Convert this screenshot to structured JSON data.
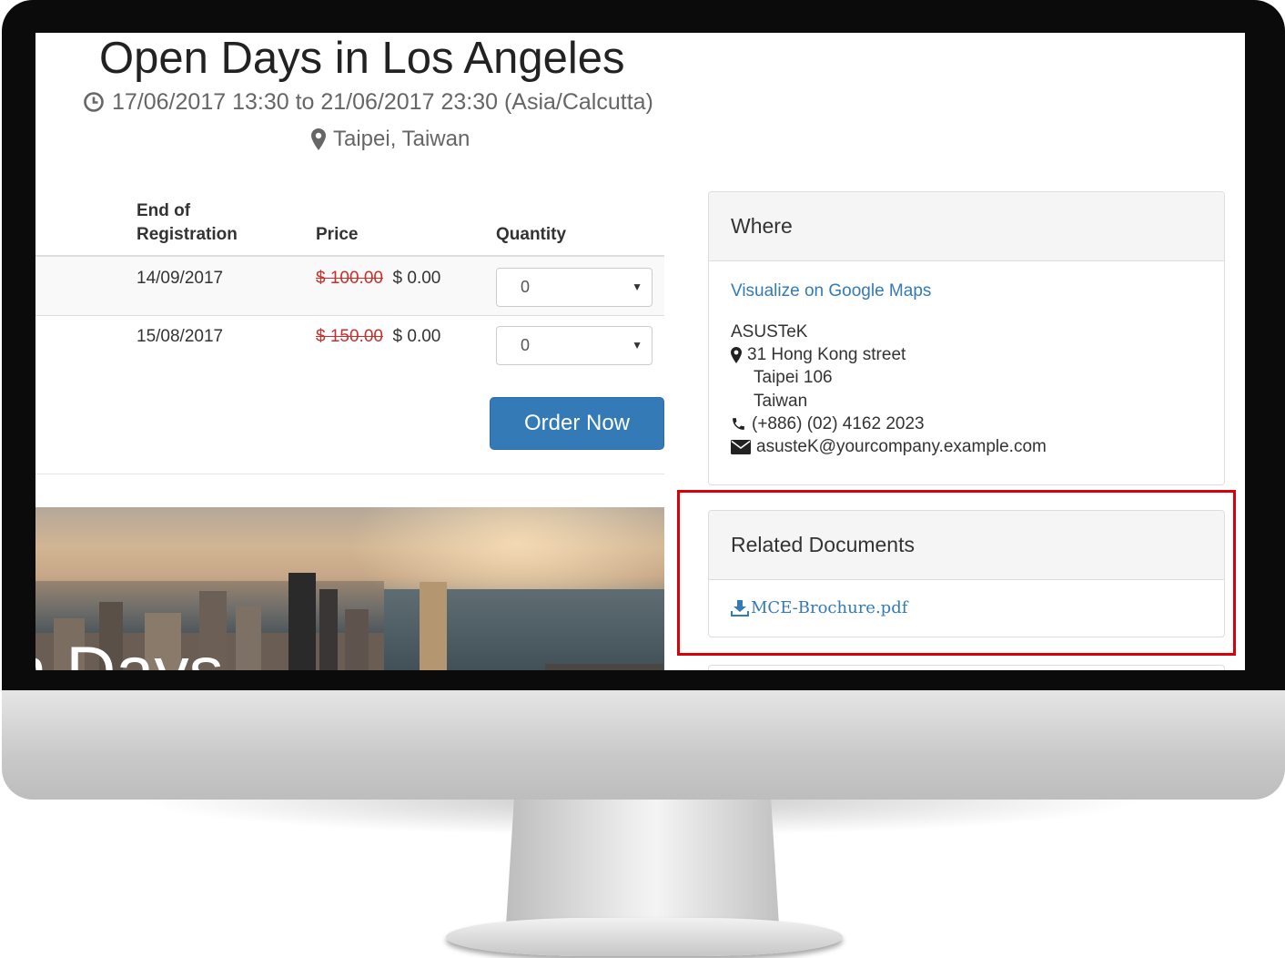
{
  "event": {
    "title": "Open Days in Los Angeles",
    "dates": "17/06/2017 13:30 to 21/06/2017 23:30 (Asia/Calcutta)",
    "location": "Taipei, Taiwan"
  },
  "tickets": {
    "headers": {
      "end_line1": "End of",
      "end_line2": "Registration",
      "price": "Price",
      "quantity": "Quantity"
    },
    "rows": [
      {
        "end": "14/09/2017",
        "old_price": "$ 100.00",
        "price": "$ 0.00",
        "quantity": "0"
      },
      {
        "end": "15/08/2017",
        "old_price": "$ 150.00",
        "price": "$ 0.00",
        "quantity": "0"
      }
    ],
    "order_label": "Order Now"
  },
  "banner": {
    "caption": "n Days"
  },
  "where": {
    "heading": "Where",
    "maps_link": "Visualize on Google Maps",
    "company": "ASUSTeK",
    "street": "31 Hong Kong street",
    "city": "Taipei 106",
    "country": "Taiwan",
    "phone": "(+886) (02) 4162 2023",
    "email": "asusteK@yourcompany.example.com"
  },
  "documents": {
    "heading": "Related Documents",
    "file": "MCE-Brochure.pdf"
  },
  "colors": {
    "link": "#337ab7",
    "button": "#337ab7",
    "strike": "#c9302c",
    "highlight": "#d9000a"
  }
}
